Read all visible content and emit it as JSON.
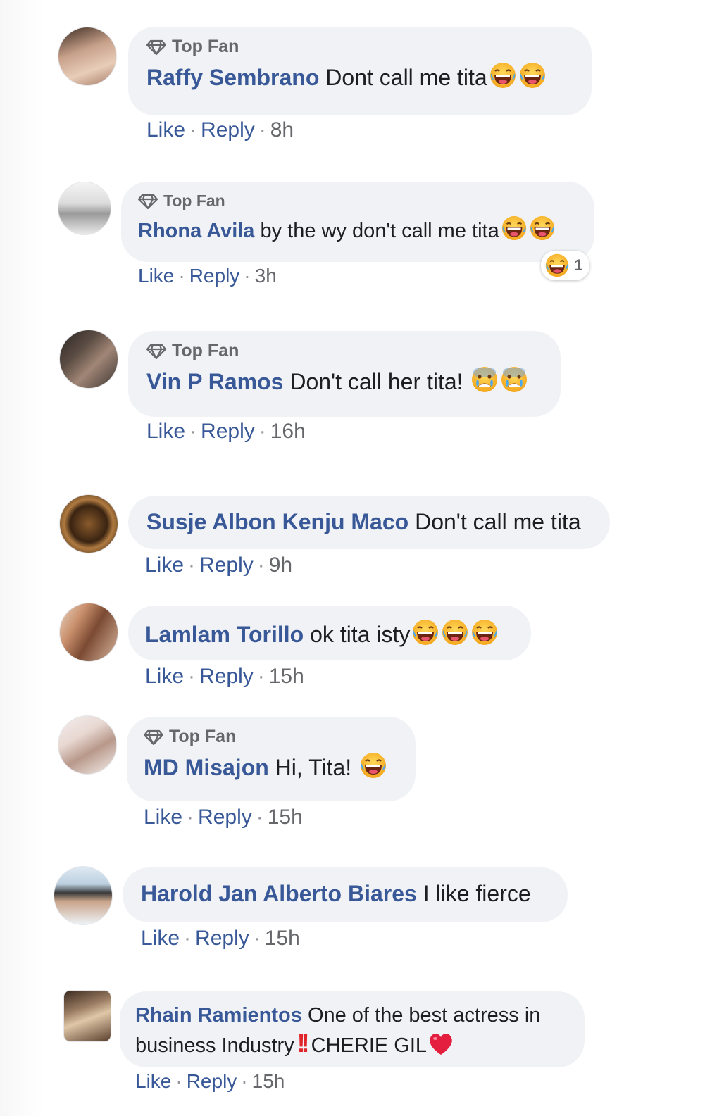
{
  "badge_label": "Top Fan",
  "actions": {
    "like": "Like",
    "reply": "Reply"
  },
  "colors": {
    "name": "#385898",
    "bubble": "#f0f2f5",
    "meta": "#65676b",
    "heart": "#e41e3f",
    "warning": "#e0242c"
  },
  "comments": [
    {
      "name": "Raffy Sembrano",
      "text": "Dont call me tita",
      "top_fan": true,
      "emojis": [
        "laughing-tears",
        "laughing-tears"
      ],
      "time": "8h"
    },
    {
      "name": "Rhona Avila",
      "text": "by the wy don't call me tita",
      "top_fan": true,
      "emojis": [
        "laughing-tears",
        "laughing-tears"
      ],
      "time": "3h",
      "reaction": {
        "icon": "haha-reaction",
        "count": "1"
      }
    },
    {
      "name": "Vin P Ramos",
      "text": "Don't call her tita!",
      "top_fan": true,
      "emojis": [
        "crying-face",
        "crying-face"
      ],
      "time": "16h"
    },
    {
      "name": "Susje Albon Kenju Maco",
      "text": "Don't call me tita",
      "top_fan": false,
      "emojis": [],
      "time": "9h"
    },
    {
      "name": "Lamlam Torillo",
      "text": "ok tita isty",
      "top_fan": false,
      "emojis": [
        "laughing-tears",
        "laughing-tears",
        "laughing-tears"
      ],
      "time": "15h"
    },
    {
      "name": "MD Misajon",
      "text": "Hi, Tita!",
      "top_fan": true,
      "emojis": [
        "laughing-tears"
      ],
      "time": "15h"
    },
    {
      "name": "Harold Jan Alberto Biares",
      "text": "I like fierce",
      "top_fan": false,
      "emojis": [],
      "time": "15h"
    },
    {
      "name": "Rhain Ramientos",
      "text_line1": "One of the best actress in",
      "text_line2_a": "business Industry",
      "text_line2_b": "CHERIE GIL",
      "top_fan": false,
      "emojis": [
        "double-exclamation",
        "red-heart"
      ],
      "time": "15h"
    }
  ]
}
